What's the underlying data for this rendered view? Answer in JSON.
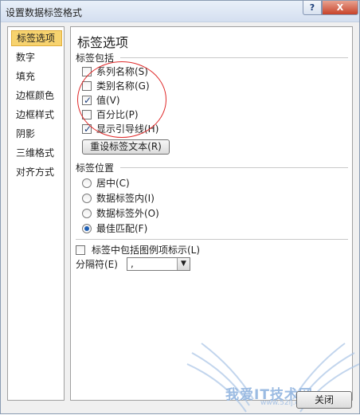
{
  "window": {
    "title": "设置数据标签格式",
    "help_glyph": "?",
    "close_glyph": "X"
  },
  "nav": {
    "items": [
      {
        "label": "标签选项",
        "selected": true
      },
      {
        "label": "数字"
      },
      {
        "label": "填充"
      },
      {
        "label": "边框颜色"
      },
      {
        "label": "边框样式"
      },
      {
        "label": "阴影"
      },
      {
        "label": "三维格式"
      },
      {
        "label": "对齐方式"
      }
    ]
  },
  "main": {
    "heading": "标签选项",
    "label_contains": {
      "section_title": "标签包括",
      "options": [
        {
          "label": "系列名称(S)",
          "checked": false
        },
        {
          "label": "类别名称(G)",
          "checked": false
        },
        {
          "label": "值(V)",
          "checked": true
        },
        {
          "label": "百分比(P)",
          "checked": false
        },
        {
          "label": "显示引导线(H)",
          "checked": true
        }
      ],
      "reset_button": "重设标签文本(R)"
    },
    "label_position": {
      "section_title": "标签位置",
      "options": [
        {
          "label": "居中(C)",
          "selected": false
        },
        {
          "label": "数据标签内(I)",
          "selected": false
        },
        {
          "label": "数据标签外(O)",
          "selected": false
        },
        {
          "label": "最佳匹配(F)",
          "selected": true
        }
      ]
    },
    "include_legend_key": {
      "label": "标签中包括图例项标示(L)",
      "checked": false
    },
    "separator": {
      "label": "分隔符(E)",
      "value": ","
    }
  },
  "footer": {
    "close_button": "关闭"
  },
  "watermark": {
    "text": "我爱IT技术网",
    "url": "www.52ij.com"
  },
  "colors": {
    "selection": "#f7d36f",
    "annotation": "#e02a2a",
    "watermark": "#9bbbe2"
  }
}
